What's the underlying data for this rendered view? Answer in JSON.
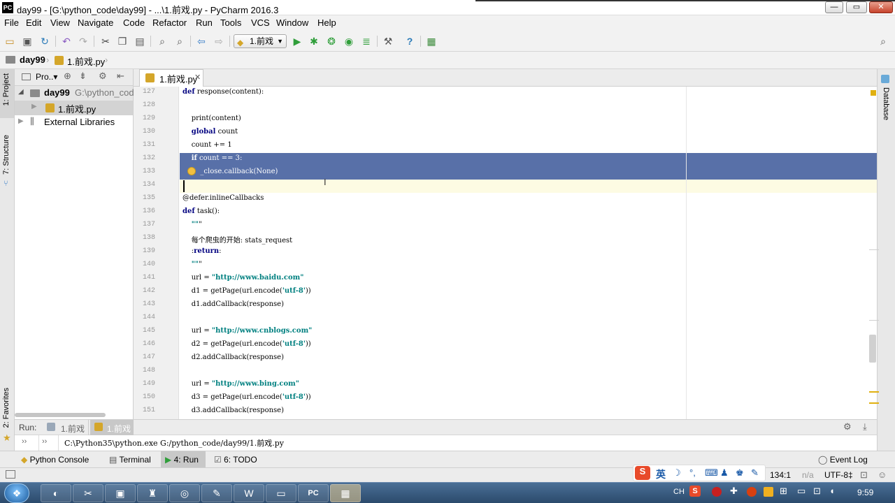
{
  "window": {
    "title": "day99 - [G:\\python_code\\day99] - ...\\1.前戏.py - PyCharm 2016.3",
    "logo": "PC",
    "min": "—",
    "max": "▭",
    "close": "✕"
  },
  "menu": [
    "File",
    "Edit",
    "View",
    "Navigate",
    "Code",
    "Refactor",
    "Run",
    "Tools",
    "VCS",
    "Window",
    "Help"
  ],
  "toolbar": {
    "run_config": "1.前戏"
  },
  "breadcrumb": {
    "project": "day99",
    "file": "1.前戏.py"
  },
  "project_panel": {
    "title": "Pro..▾",
    "root_name": "day99",
    "root_path": "G:\\python_cod",
    "file": "1.前戏.py",
    "libs": "External Libraries"
  },
  "left_tabs": {
    "project": "1: Project",
    "structure": "7: Structure",
    "favorites": "2: Favorites"
  },
  "right_tabs": {
    "database": "Database"
  },
  "editor": {
    "tab": "1.前戏.py",
    "lines": [
      {
        "n": "127",
        "text": "def response(content):"
      },
      {
        "n": "128",
        "text": ""
      },
      {
        "n": "129",
        "text": "    print(content)"
      },
      {
        "n": "130",
        "text": "    global count"
      },
      {
        "n": "131",
        "text": "    count += 1"
      },
      {
        "n": "132",
        "text": "    if count == 3:"
      },
      {
        "n": "133",
        "text": "        _close.callback(None)"
      },
      {
        "n": "134",
        "text": ""
      },
      {
        "n": "135",
        "text": "@defer.inlineCallbacks"
      },
      {
        "n": "136",
        "text": "def task():"
      },
      {
        "n": "137",
        "text": "    \"\"\""
      },
      {
        "n": "138",
        "text": "    每个爬虫的开始: stats_request"
      },
      {
        "n": "139",
        "text": "    :return:"
      },
      {
        "n": "140",
        "text": "    \"\"\""
      },
      {
        "n": "141",
        "text": "    url = \"http://www.baidu.com\""
      },
      {
        "n": "142",
        "text": "    d1 = getPage(url.encode('utf-8'))"
      },
      {
        "n": "143",
        "text": "    d1.addCallback(response)"
      },
      {
        "n": "144",
        "text": ""
      },
      {
        "n": "145",
        "text": "    url = \"http://www.cnblogs.com\""
      },
      {
        "n": "146",
        "text": "    d2 = getPage(url.encode('utf-8'))"
      },
      {
        "n": "147",
        "text": "    d2.addCallback(response)"
      },
      {
        "n": "148",
        "text": ""
      },
      {
        "n": "149",
        "text": "    url = \"http://www.bing.com\""
      },
      {
        "n": "150",
        "text": "    d3 = getPage(url.encode('utf-8'))"
      },
      {
        "n": "151",
        "text": "    d3.addCallback(response)"
      }
    ]
  },
  "run_panel": {
    "label": "Run:",
    "tab1": "1.前戏",
    "tab2": "1.前戏",
    "command": "C:\\Python35\\python.exe G:/python_code/day99/1.前戏.py",
    "gear": "⚙",
    "more": "››"
  },
  "tool_windows": {
    "python_console": "Python Console",
    "terminal": "Terminal",
    "run": "4: Run",
    "todo": "6: TODO",
    "event_log": "Event Log"
  },
  "status": {
    "position": "134:1",
    "na": "n/a",
    "encoding": "UTF-8‡"
  },
  "taskbar": {
    "ime": "CH",
    "clock": "9:59",
    "ime_lang": "英"
  }
}
